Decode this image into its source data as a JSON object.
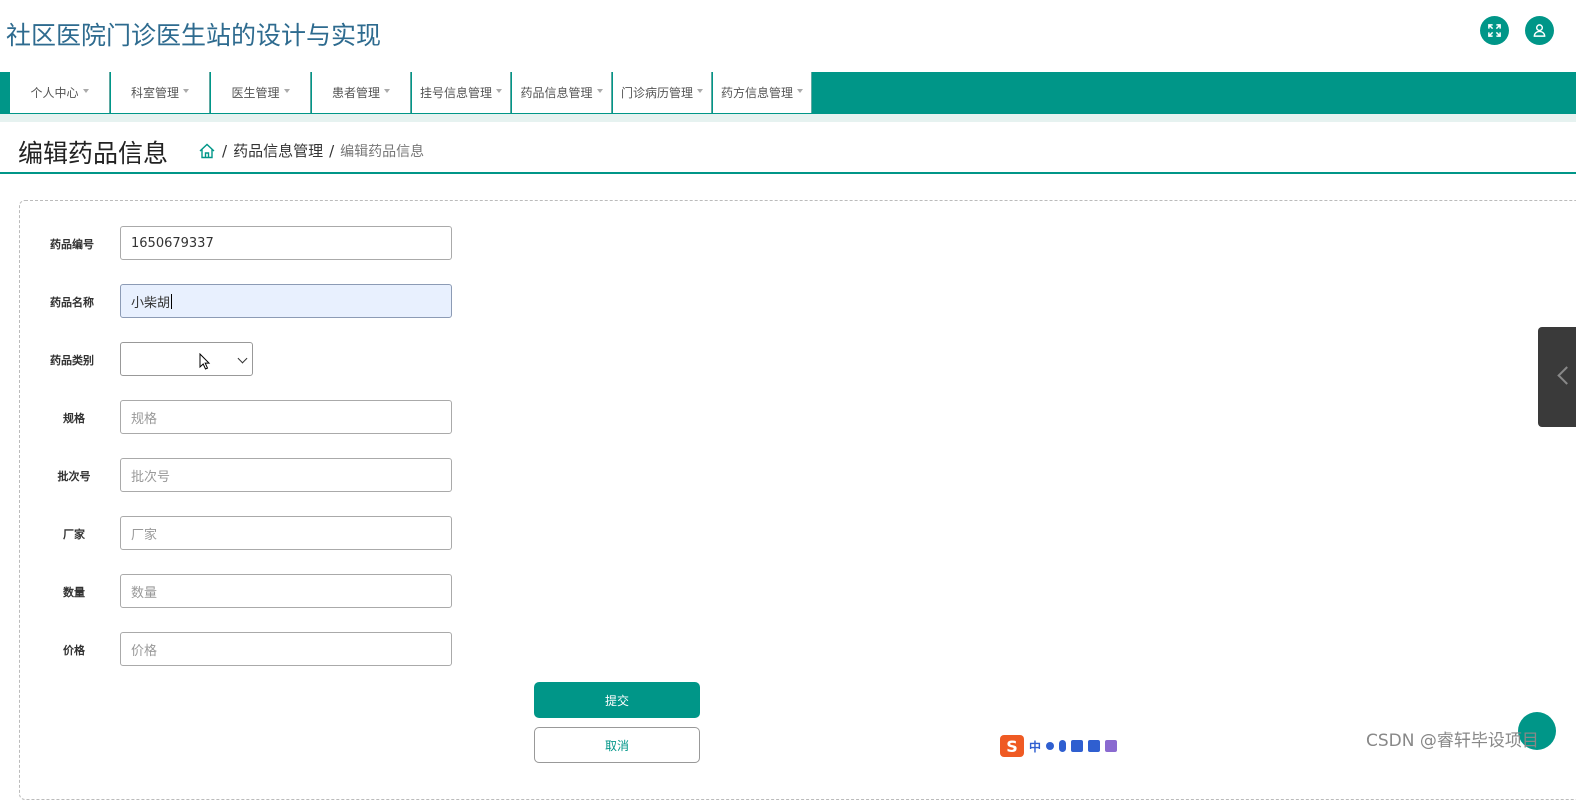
{
  "app": {
    "title": "社区医院门诊医生站的设计与实现"
  },
  "header_buttons": [
    {
      "name": "fullscreen",
      "icon": "expand-icon"
    },
    {
      "name": "user",
      "icon": "user-icon"
    }
  ],
  "nav": {
    "items": [
      {
        "label": "个人中心"
      },
      {
        "label": "科室管理"
      },
      {
        "label": "医生管理"
      },
      {
        "label": "患者管理"
      },
      {
        "label": "挂号信息管理"
      },
      {
        "label": "药品信息管理"
      },
      {
        "label": "门诊病历管理"
      },
      {
        "label": "药方信息管理"
      }
    ]
  },
  "page": {
    "title": "编辑药品信息",
    "breadcrumb": {
      "home_icon": "home-icon",
      "sep": "/",
      "parent": "药品信息管理",
      "current": "编辑药品信息"
    }
  },
  "form": {
    "drug_id": {
      "label": "药品编号",
      "value": "1650679337"
    },
    "drug_name": {
      "label": "药品名称",
      "value": "小柴胡"
    },
    "drug_category": {
      "label": "药品类别",
      "value": ""
    },
    "spec": {
      "label": "规格",
      "placeholder": "规格"
    },
    "batch": {
      "label": "批次号",
      "placeholder": "批次号"
    },
    "maker": {
      "label": "厂家",
      "placeholder": "厂家"
    },
    "qty": {
      "label": "数量",
      "placeholder": "数量"
    },
    "price": {
      "label": "价格",
      "placeholder": "价格"
    },
    "submit_label": "提交",
    "cancel_label": "取消"
  },
  "ime": {
    "logo": "S",
    "mode": "中"
  },
  "watermark": "CSDN @睿轩毕设项目",
  "colors": {
    "primary": "#009688",
    "title": "#2e6b8f",
    "focus_bg": "#e8f0fe"
  }
}
